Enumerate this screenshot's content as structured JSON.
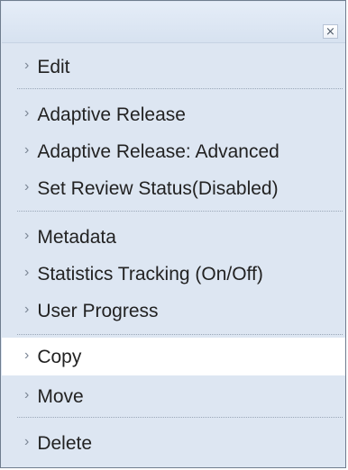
{
  "menu": {
    "close_symbol": "×",
    "items": [
      {
        "label": "Edit",
        "icon": "chevron-right-icon"
      },
      {
        "label": "Adaptive Release",
        "icon": "chevron-right-icon"
      },
      {
        "label": "Adaptive Release: Advanced",
        "icon": "chevron-right-icon"
      },
      {
        "label": "Set Review Status(Disabled)",
        "icon": "chevron-right-icon"
      },
      {
        "label": "Metadata",
        "icon": "chevron-right-icon"
      },
      {
        "label": "Statistics Tracking (On/Off)",
        "icon": "chevron-right-icon"
      },
      {
        "label": "User Progress",
        "icon": "chevron-right-icon"
      },
      {
        "label": "Copy",
        "icon": "chevron-right-icon",
        "state": "highlighted"
      },
      {
        "label": "Move",
        "icon": "chevron-right-icon"
      },
      {
        "label": "Delete",
        "icon": "chevron-right-icon"
      }
    ],
    "chevron_symbol": "›",
    "colors": {
      "menu_bg": "#dde6f2",
      "header_bg": "#e5edf8",
      "highlight_bg": "#ffffff",
      "border": "#6f7d8f",
      "text": "#222222"
    }
  }
}
